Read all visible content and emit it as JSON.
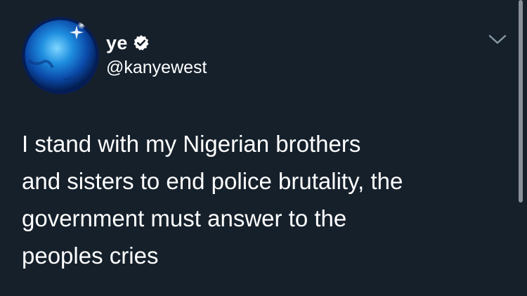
{
  "colors": {
    "background": "#15202b",
    "text": "#ffffff",
    "chevron": "#8899a6",
    "scrollbar": "#8b9198"
  },
  "author": {
    "avatar_icon": "blue-planet-avatar",
    "display_name": "ye",
    "verified_icon": "verified-badge-icon",
    "handle": "@kanyewest"
  },
  "menu": {
    "icon": "chevron-down-icon"
  },
  "tweet": {
    "text": "I stand with my Nigerian brothers\nand sisters to end police brutality, the\ngovernment must answer to the\npeoples cries"
  }
}
